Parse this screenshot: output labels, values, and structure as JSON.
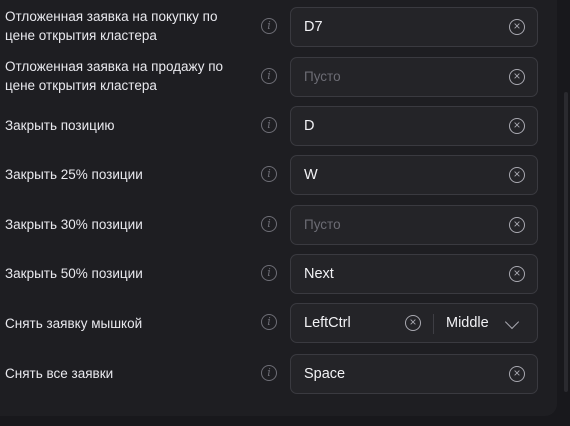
{
  "rows": [
    {
      "label_lines": [
        "Отложенная заявка на покупку по",
        "цене открытия кластера"
      ],
      "value": "D7",
      "placeholder": ""
    },
    {
      "label_lines": [
        "Отложенная заявка на продажу по",
        "цене открытия кластера"
      ],
      "value": "",
      "placeholder": "Пусто"
    },
    {
      "label_lines": [
        "Закрыть позицию"
      ],
      "value": "D",
      "placeholder": ""
    },
    {
      "label_lines": [
        "Закрыть 25% позиции"
      ],
      "value": "W",
      "placeholder": ""
    },
    {
      "label_lines": [
        "Закрыть 30% позиции"
      ],
      "value": "",
      "placeholder": "Пусто"
    },
    {
      "label_lines": [
        "Закрыть 50% позиции"
      ],
      "value": "Next",
      "placeholder": ""
    },
    {
      "label_lines": [
        "Снять заявку мышкой"
      ],
      "value": "LeftCtrl",
      "placeholder": "",
      "mouse_button": "Middle"
    },
    {
      "label_lines": [
        "Снять все заявки"
      ],
      "value": "Space",
      "placeholder": ""
    }
  ],
  "icons": {
    "info": "info-icon",
    "clear": "clear-circle-x-icon",
    "dropdown": "chevron-down-icon"
  },
  "colors": {
    "background": "#1e1e22",
    "field_bg": "#242428",
    "field_border": "#3a3a40",
    "placeholder": "#6c6c74"
  }
}
